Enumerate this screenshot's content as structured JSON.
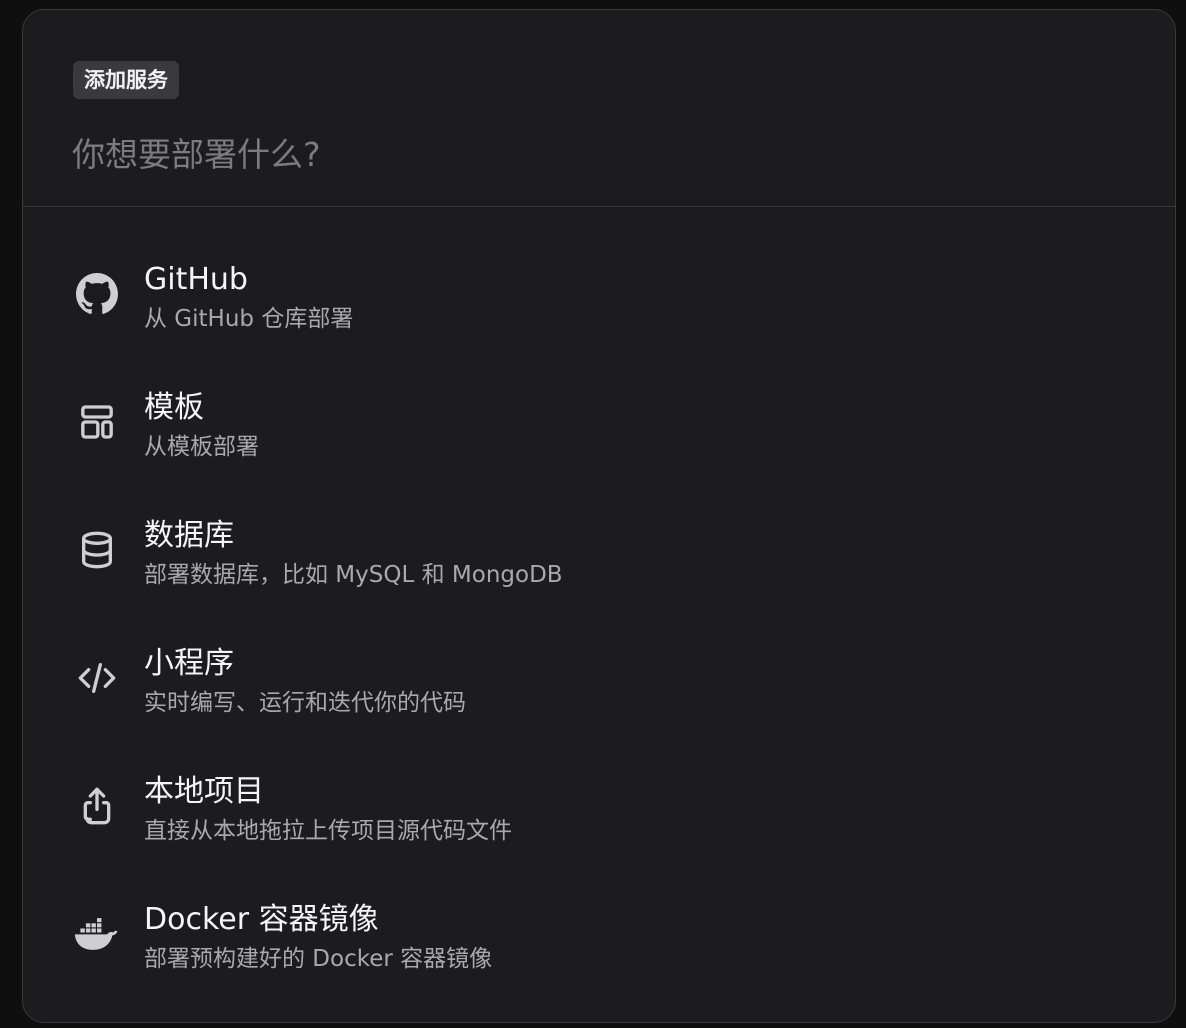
{
  "dialog": {
    "badge": "添加服务",
    "search_placeholder": "你想要部署什么?",
    "search_value": ""
  },
  "options": [
    {
      "icon": "github-icon",
      "title": "GitHub",
      "description": "从 GitHub 仓库部署"
    },
    {
      "icon": "template-icon",
      "title": "模板",
      "description": "从模板部署"
    },
    {
      "icon": "database-icon",
      "title": "数据库",
      "description": "部署数据库，比如 MySQL 和 MongoDB"
    },
    {
      "icon": "code-icon",
      "title": "小程序",
      "description": "实时编写、运行和迭代你的代码"
    },
    {
      "icon": "upload-icon",
      "title": "本地项目",
      "description": "直接从本地拖拉上传项目源代码文件"
    },
    {
      "icon": "docker-icon",
      "title": "Docker 容器镜像",
      "description": "部署预构建好的 Docker 容器镜像"
    }
  ],
  "colors": {
    "background": "#1c1c1e",
    "icon": "#cfcfd3",
    "title": "#f5f5f5",
    "description": "#a9a9ad"
  }
}
